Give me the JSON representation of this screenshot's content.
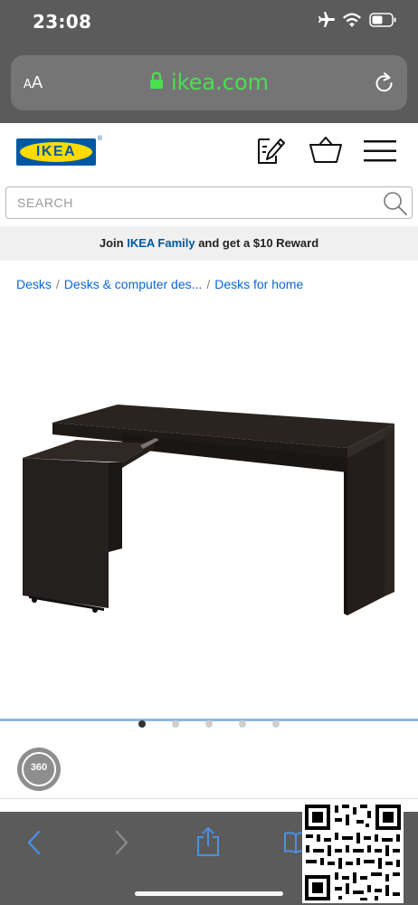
{
  "status_bar": {
    "time": "23:08",
    "icons": [
      "airplane-icon",
      "wifi-icon",
      "battery-icon"
    ]
  },
  "browser": {
    "text_size_label": "AA",
    "url": "ikea.com",
    "lock_icon": "lock-icon",
    "reload_icon": "reload-icon"
  },
  "header": {
    "logo_text": "IKEA",
    "logo_registered": "®",
    "icons": [
      "shopping-list-icon",
      "cart-icon",
      "menu-icon"
    ],
    "brand_colors": {
      "blue": "#0058a3",
      "yellow": "#ffdb00"
    }
  },
  "search": {
    "placeholder": "SEARCH"
  },
  "promo": {
    "prefix": "Join",
    "highlight": "IKEA Family",
    "suffix": "and get a $10 Reward"
  },
  "breadcrumb": {
    "items": [
      "Desks",
      "Desks & computer des...",
      "Desks for home"
    ],
    "separator": "/"
  },
  "product": {
    "image_icon": "desk-image",
    "carousel_total": 5,
    "carousel_active": 1
  },
  "badge": {
    "label": "360"
  },
  "toolbar": {
    "icons": [
      "back-icon",
      "forward-icon",
      "share-icon",
      "bookmarks-icon"
    ]
  }
}
